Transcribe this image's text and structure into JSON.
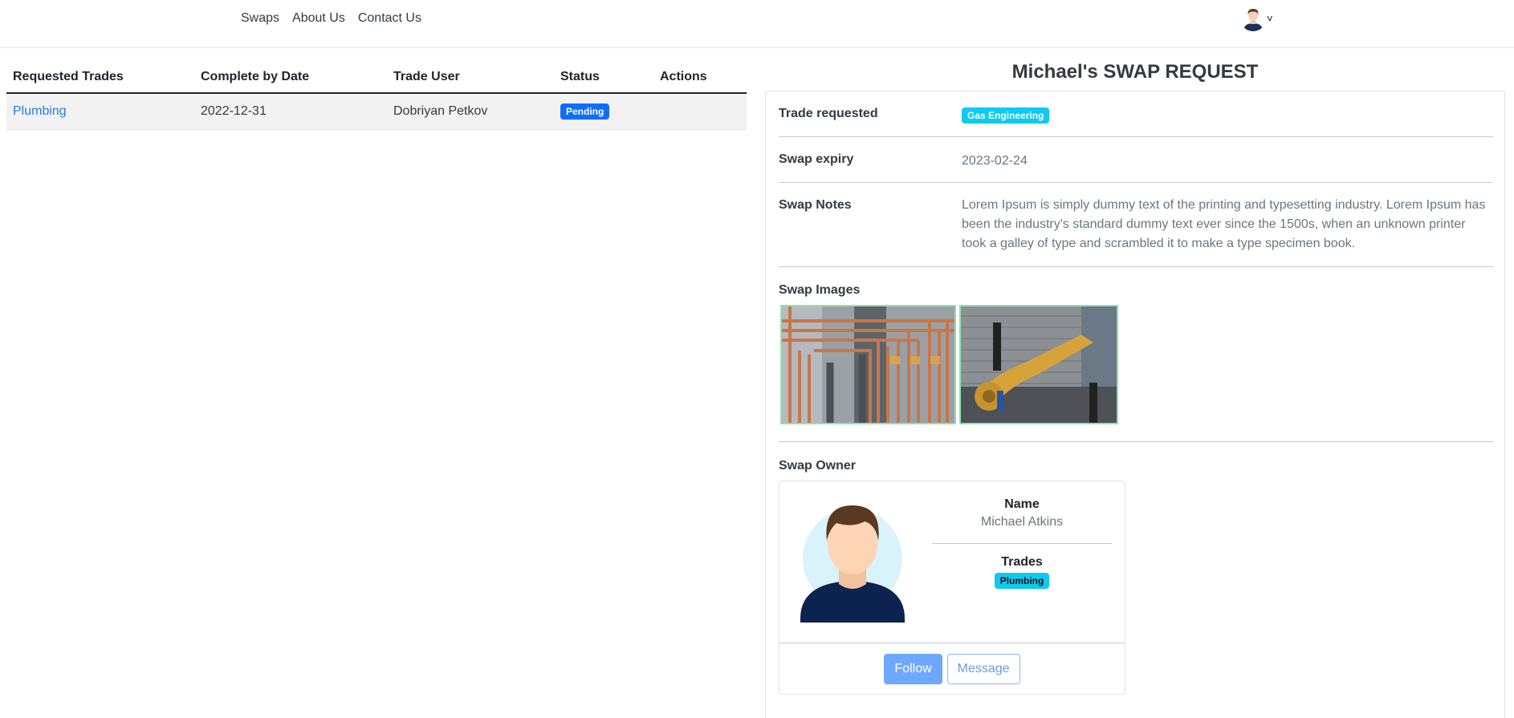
{
  "nav": {
    "links": [
      "Swaps",
      "About Us",
      "Contact Us"
    ],
    "user_caret": "v"
  },
  "table": {
    "headers": [
      "Requested Trades",
      "Complete by Date",
      "Trade User",
      "Status",
      "Actions"
    ],
    "rows": [
      {
        "trade": "Plumbing",
        "date": "2022-12-31",
        "user": "Dobriyan Petkov",
        "status": "Pending",
        "actions": ""
      }
    ]
  },
  "detail": {
    "title": "Michael's SWAP REQUEST",
    "trade_requested_label": "Trade requested",
    "trade_requested_value": "Gas Engineering",
    "expiry_label": "Swap expiry",
    "expiry_value": "2023-02-24",
    "notes_label": "Swap Notes",
    "notes_value": "Lorem Ipsum is simply dummy text of the printing and typesetting industry. Lorem Ipsum has been the industry's standard dummy text ever since the 1500s, when an unknown printer took a galley of type and scrambled it to make a type specimen book.",
    "images_label": "Swap Images",
    "owner_label": "Swap Owner",
    "owner": {
      "name_label": "Name",
      "name": "Michael Atkins",
      "trades_label": "Trades",
      "trades": [
        "Plumbing"
      ],
      "follow_label": "Follow",
      "message_label": "Message"
    }
  },
  "colors": {
    "link": "#2a7ae2",
    "pending_badge": "#0d6efd",
    "info_badge": "#0dcaf0",
    "image_border": "#8ee2b1",
    "follow_button": "#6ea8fe"
  }
}
